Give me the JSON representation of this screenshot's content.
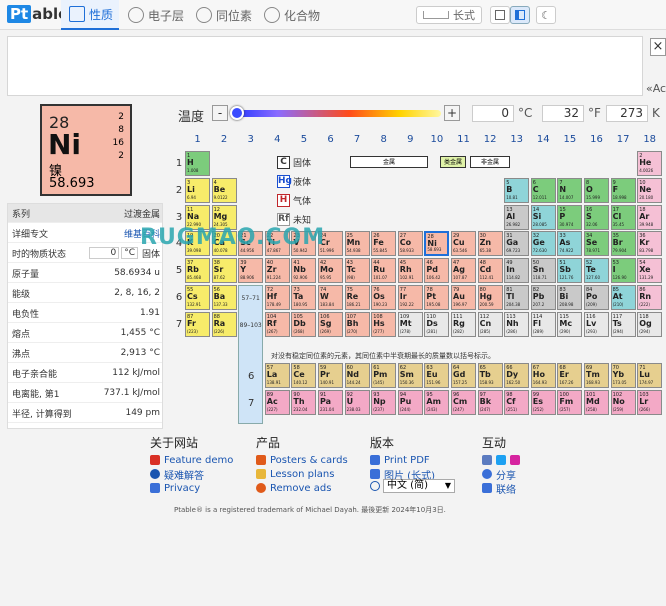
{
  "app": {
    "logo_prefix": "Pt",
    "logo_suffix": "able"
  },
  "tabs": [
    {
      "label": "性质",
      "active": true
    },
    {
      "label": "电子层",
      "active": false
    },
    {
      "label": "同位素",
      "active": false
    },
    {
      "label": "化合物",
      "active": false
    }
  ],
  "layout_buttons": {
    "wide_label": "长式"
  },
  "close_label": "×",
  "right_clip_text": "«Ac",
  "temperature": {
    "label": "温度",
    "minus": "-",
    "plus": "+",
    "celsius": "0",
    "celsius_unit": "°C",
    "fahrenheit": "32",
    "fahrenheit_unit": "°F",
    "kelvin": "273",
    "kelvin_unit": "K"
  },
  "selected": {
    "number": "28",
    "symbol": "Ni",
    "name": "镍",
    "mass": "58.693",
    "shells": [
      "2",
      "8",
      "16",
      "2"
    ]
  },
  "properties": {
    "header_key": "系列",
    "header_value": "过渡金属",
    "rows": [
      {
        "k": "详细专文",
        "v": "维基百科"
      },
      {
        "k": "时的物质状态",
        "v": "固体"
      },
      {
        "k": "原子量",
        "v": "58.6934 u"
      },
      {
        "k": "能级",
        "v": "2, 8, 16, 2"
      },
      {
        "k": "电负性",
        "v": "1.91"
      },
      {
        "k": "熔点",
        "v": "1,455 °C"
      },
      {
        "k": "沸点",
        "v": "2,913 °C"
      },
      {
        "k": "电子亲合能",
        "v": "112 kJ/mol"
      },
      {
        "k": "电离能, 第1",
        "v": "737.1 kJ/mol"
      },
      {
        "k": "半径, 计算得到",
        "v": "149 pm"
      }
    ],
    "state_temp": "0",
    "state_unit": "°C"
  },
  "groups": [
    "1",
    "2",
    "3",
    "4",
    "5",
    "6",
    "7",
    "8",
    "9",
    "10",
    "11",
    "12",
    "13",
    "14",
    "15",
    "16",
    "17",
    "18"
  ],
  "periods": [
    "1",
    "2",
    "3",
    "4",
    "5",
    "6",
    "7"
  ],
  "lanth_period": "6",
  "actin_period": "7",
  "range_6": "57–71",
  "range_7": "89–103",
  "legend": [
    {
      "sym": "C",
      "label": "固体",
      "color": "#000000"
    },
    {
      "sym": "Hg",
      "label": "液体",
      "color": "#1a4fd0"
    },
    {
      "sym": "H",
      "label": "气体",
      "color": "#c0262a"
    },
    {
      "sym": "Rf",
      "label": "未知",
      "color": "#555555"
    }
  ],
  "category_headers": {
    "metal": "金属",
    "nonmetal": "非金属",
    "metalloid": "类金属"
  },
  "note": "对没有稳定同位素的元素，其同位素中半衰期最长的质量数以括号标示。",
  "watermark": "RUGMAO.COM",
  "elements": [
    {
      "n": "1",
      "s": "H",
      "m": "1.008",
      "g": 1,
      "p": 1,
      "c": "#7ccc7c"
    },
    {
      "n": "2",
      "s": "He",
      "m": "4.0026",
      "g": 18,
      "p": 1,
      "c": "#f5c0d5"
    },
    {
      "n": "3",
      "s": "Li",
      "m": "6.94",
      "g": 1,
      "p": 2,
      "c": "#f7ec6a"
    },
    {
      "n": "4",
      "s": "Be",
      "m": "9.0122",
      "g": 2,
      "p": 2,
      "c": "#f7ec6a"
    },
    {
      "n": "5",
      "s": "B",
      "m": "10.81",
      "g": 13,
      "p": 2,
      "c": "#8fd4d8"
    },
    {
      "n": "6",
      "s": "C",
      "m": "12.011",
      "g": 14,
      "p": 2,
      "c": "#7ccc7c"
    },
    {
      "n": "7",
      "s": "N",
      "m": "14.007",
      "g": 15,
      "p": 2,
      "c": "#7ccc7c"
    },
    {
      "n": "8",
      "s": "O",
      "m": "15.999",
      "g": 16,
      "p": 2,
      "c": "#7ccc7c"
    },
    {
      "n": "9",
      "s": "F",
      "m": "18.998",
      "g": 17,
      "p": 2,
      "c": "#7ccc7c"
    },
    {
      "n": "10",
      "s": "Ne",
      "m": "20.180",
      "g": 18,
      "p": 2,
      "c": "#f5c0d5"
    },
    {
      "n": "11",
      "s": "Na",
      "m": "22.990",
      "g": 1,
      "p": 3,
      "c": "#f7ec6a"
    },
    {
      "n": "12",
      "s": "Mg",
      "m": "24.305",
      "g": 2,
      "p": 3,
      "c": "#f7ec6a"
    },
    {
      "n": "13",
      "s": "Al",
      "m": "26.982",
      "g": 13,
      "p": 3,
      "c": "#c9c9c9"
    },
    {
      "n": "14",
      "s": "Si",
      "m": "28.085",
      "g": 14,
      "p": 3,
      "c": "#8fd4d8"
    },
    {
      "n": "15",
      "s": "P",
      "m": "30.974",
      "g": 15,
      "p": 3,
      "c": "#7ccc7c"
    },
    {
      "n": "16",
      "s": "S",
      "m": "32.06",
      "g": 16,
      "p": 3,
      "c": "#7ccc7c"
    },
    {
      "n": "17",
      "s": "Cl",
      "m": "35.45",
      "g": 17,
      "p": 3,
      "c": "#7ccc7c"
    },
    {
      "n": "18",
      "s": "Ar",
      "m": "39.948",
      "g": 18,
      "p": 3,
      "c": "#f5c0d5"
    },
    {
      "n": "19",
      "s": "K",
      "m": "39.098",
      "g": 1,
      "p": 4,
      "c": "#f7ec6a"
    },
    {
      "n": "20",
      "s": "Ca",
      "m": "40.078",
      "g": 2,
      "p": 4,
      "c": "#f7ec6a"
    },
    {
      "n": "21",
      "s": "Sc",
      "m": "44.956",
      "g": 3,
      "p": 4,
      "c": "#f6b9a8"
    },
    {
      "n": "22",
      "s": "Ti",
      "m": "47.867",
      "g": 4,
      "p": 4,
      "c": "#f6b9a8"
    },
    {
      "n": "23",
      "s": "V",
      "m": "50.942",
      "g": 5,
      "p": 4,
      "c": "#f6b9a8"
    },
    {
      "n": "24",
      "s": "Cr",
      "m": "51.996",
      "g": 6,
      "p": 4,
      "c": "#f6b9a8"
    },
    {
      "n": "25",
      "s": "Mn",
      "m": "54.938",
      "g": 7,
      "p": 4,
      "c": "#f6b9a8"
    },
    {
      "n": "26",
      "s": "Fe",
      "m": "55.845",
      "g": 8,
      "p": 4,
      "c": "#f6b9a8"
    },
    {
      "n": "27",
      "s": "Co",
      "m": "58.933",
      "g": 9,
      "p": 4,
      "c": "#f6b9a8"
    },
    {
      "n": "28",
      "s": "Ni",
      "m": "58.693",
      "g": 10,
      "p": 4,
      "c": "#f6b9a8"
    },
    {
      "n": "29",
      "s": "Cu",
      "m": "63.546",
      "g": 11,
      "p": 4,
      "c": "#f6b9a8"
    },
    {
      "n": "30",
      "s": "Zn",
      "m": "65.38",
      "g": 12,
      "p": 4,
      "c": "#f6b9a8"
    },
    {
      "n": "31",
      "s": "Ga",
      "m": "69.723",
      "g": 13,
      "p": 4,
      "c": "#c9c9c9"
    },
    {
      "n": "32",
      "s": "Ge",
      "m": "72.630",
      "g": 14,
      "p": 4,
      "c": "#8fd4d8"
    },
    {
      "n": "33",
      "s": "As",
      "m": "74.922",
      "g": 15,
      "p": 4,
      "c": "#8fd4d8"
    },
    {
      "n": "34",
      "s": "Se",
      "m": "78.971",
      "g": 16,
      "p": 4,
      "c": "#7ccc7c"
    },
    {
      "n": "35",
      "s": "Br",
      "m": "79.904",
      "g": 17,
      "p": 4,
      "c": "#7ccc7c"
    },
    {
      "n": "36",
      "s": "Kr",
      "m": "83.798",
      "g": 18,
      "p": 4,
      "c": "#f5c0d5"
    },
    {
      "n": "37",
      "s": "Rb",
      "m": "85.468",
      "g": 1,
      "p": 5,
      "c": "#f7ec6a"
    },
    {
      "n": "38",
      "s": "Sr",
      "m": "87.62",
      "g": 2,
      "p": 5,
      "c": "#f7ec6a"
    },
    {
      "n": "39",
      "s": "Y",
      "m": "88.906",
      "g": 3,
      "p": 5,
      "c": "#f6b9a8"
    },
    {
      "n": "40",
      "s": "Zr",
      "m": "91.224",
      "g": 4,
      "p": 5,
      "c": "#f6b9a8"
    },
    {
      "n": "41",
      "s": "Nb",
      "m": "92.906",
      "g": 5,
      "p": 5,
      "c": "#f6b9a8"
    },
    {
      "n": "42",
      "s": "Mo",
      "m": "95.95",
      "g": 6,
      "p": 5,
      "c": "#f6b9a8"
    },
    {
      "n": "43",
      "s": "Tc",
      "m": "(98)",
      "g": 7,
      "p": 5,
      "c": "#f6b9a8"
    },
    {
      "n": "44",
      "s": "Ru",
      "m": "101.07",
      "g": 8,
      "p": 5,
      "c": "#f6b9a8"
    },
    {
      "n": "45",
      "s": "Rh",
      "m": "102.91",
      "g": 9,
      "p": 5,
      "c": "#f6b9a8"
    },
    {
      "n": "46",
      "s": "Pd",
      "m": "106.42",
      "g": 10,
      "p": 5,
      "c": "#f6b9a8"
    },
    {
      "n": "47",
      "s": "Ag",
      "m": "107.87",
      "g": 11,
      "p": 5,
      "c": "#f6b9a8"
    },
    {
      "n": "48",
      "s": "Cd",
      "m": "112.41",
      "g": 12,
      "p": 5,
      "c": "#f6b9a8"
    },
    {
      "n": "49",
      "s": "In",
      "m": "114.82",
      "g": 13,
      "p": 5,
      "c": "#c9c9c9"
    },
    {
      "n": "50",
      "s": "Sn",
      "m": "118.71",
      "g": 14,
      "p": 5,
      "c": "#c9c9c9"
    },
    {
      "n": "51",
      "s": "Sb",
      "m": "121.76",
      "g": 15,
      "p": 5,
      "c": "#8fd4d8"
    },
    {
      "n": "52",
      "s": "Te",
      "m": "127.60",
      "g": 16,
      "p": 5,
      "c": "#8fd4d8"
    },
    {
      "n": "53",
      "s": "I",
      "m": "126.90",
      "g": 17,
      "p": 5,
      "c": "#7ccc7c"
    },
    {
      "n": "54",
      "s": "Xe",
      "m": "131.29",
      "g": 18,
      "p": 5,
      "c": "#f5c0d5"
    },
    {
      "n": "55",
      "s": "Cs",
      "m": "132.91",
      "g": 1,
      "p": 6,
      "c": "#f7ec6a"
    },
    {
      "n": "56",
      "s": "Ba",
      "m": "137.33",
      "g": 2,
      "p": 6,
      "c": "#f7ec6a"
    },
    {
      "n": "72",
      "s": "Hf",
      "m": "178.49",
      "g": 4,
      "p": 6,
      "c": "#f6b9a8"
    },
    {
      "n": "73",
      "s": "Ta",
      "m": "180.95",
      "g": 5,
      "p": 6,
      "c": "#f6b9a8"
    },
    {
      "n": "74",
      "s": "W",
      "m": "183.84",
      "g": 6,
      "p": 6,
      "c": "#f6b9a8"
    },
    {
      "n": "75",
      "s": "Re",
      "m": "186.21",
      "g": 7,
      "p": 6,
      "c": "#f6b9a8"
    },
    {
      "n": "76",
      "s": "Os",
      "m": "190.23",
      "g": 8,
      "p": 6,
      "c": "#f6b9a8"
    },
    {
      "n": "77",
      "s": "Ir",
      "m": "192.22",
      "g": 9,
      "p": 6,
      "c": "#f6b9a8"
    },
    {
      "n": "78",
      "s": "Pt",
      "m": "195.08",
      "g": 10,
      "p": 6,
      "c": "#f6b9a8"
    },
    {
      "n": "79",
      "s": "Au",
      "m": "196.97",
      "g": 11,
      "p": 6,
      "c": "#f6b9a8"
    },
    {
      "n": "80",
      "s": "Hg",
      "m": "200.59",
      "g": 12,
      "p": 6,
      "c": "#f6b9a8"
    },
    {
      "n": "81",
      "s": "Tl",
      "m": "204.38",
      "g": 13,
      "p": 6,
      "c": "#c9c9c9"
    },
    {
      "n": "82",
      "s": "Pb",
      "m": "207.2",
      "g": 14,
      "p": 6,
      "c": "#c9c9c9"
    },
    {
      "n": "83",
      "s": "Bi",
      "m": "208.98",
      "g": 15,
      "p": 6,
      "c": "#c9c9c9"
    },
    {
      "n": "84",
      "s": "Po",
      "m": "(209)",
      "g": 16,
      "p": 6,
      "c": "#c9c9c9"
    },
    {
      "n": "85",
      "s": "At",
      "m": "(210)",
      "g": 17,
      "p": 6,
      "c": "#8fd4d8"
    },
    {
      "n": "86",
      "s": "Rn",
      "m": "(222)",
      "g": 18,
      "p": 6,
      "c": "#f5c0d5"
    },
    {
      "n": "87",
      "s": "Fr",
      "m": "(223)",
      "g": 1,
      "p": 7,
      "c": "#f7ec6a"
    },
    {
      "n": "88",
      "s": "Ra",
      "m": "(226)",
      "g": 2,
      "p": 7,
      "c": "#f7ec6a"
    },
    {
      "n": "104",
      "s": "Rf",
      "m": "(267)",
      "g": 4,
      "p": 7,
      "c": "#f6b9a8"
    },
    {
      "n": "105",
      "s": "Db",
      "m": "(268)",
      "g": 5,
      "p": 7,
      "c": "#f6b9a8"
    },
    {
      "n": "106",
      "s": "Sg",
      "m": "(269)",
      "g": 6,
      "p": 7,
      "c": "#f6b9a8"
    },
    {
      "n": "107",
      "s": "Bh",
      "m": "(270)",
      "g": 7,
      "p": 7,
      "c": "#f6b9a8"
    },
    {
      "n": "108",
      "s": "Hs",
      "m": "(277)",
      "g": 8,
      "p": 7,
      "c": "#f6b9a8"
    },
    {
      "n": "109",
      "s": "Mt",
      "m": "(278)",
      "g": 9,
      "p": 7,
      "c": "#e8e8e8"
    },
    {
      "n": "110",
      "s": "Ds",
      "m": "(281)",
      "g": 10,
      "p": 7,
      "c": "#e8e8e8"
    },
    {
      "n": "111",
      "s": "Rg",
      "m": "(282)",
      "g": 11,
      "p": 7,
      "c": "#e8e8e8"
    },
    {
      "n": "112",
      "s": "Cn",
      "m": "(285)",
      "g": 12,
      "p": 7,
      "c": "#e8e8e8"
    },
    {
      "n": "113",
      "s": "Nh",
      "m": "(286)",
      "g": 13,
      "p": 7,
      "c": "#e8e8e8"
    },
    {
      "n": "114",
      "s": "Fl",
      "m": "(289)",
      "g": 14,
      "p": 7,
      "c": "#e8e8e8"
    },
    {
      "n": "115",
      "s": "Mc",
      "m": "(290)",
      "g": 15,
      "p": 7,
      "c": "#e8e8e8"
    },
    {
      "n": "116",
      "s": "Lv",
      "m": "(293)",
      "g": 16,
      "p": 7,
      "c": "#e8e8e8"
    },
    {
      "n": "117",
      "s": "Ts",
      "m": "(294)",
      "g": 17,
      "p": 7,
      "c": "#e8e8e8"
    },
    {
      "n": "118",
      "s": "Og",
      "m": "(294)",
      "g": 18,
      "p": 7,
      "c": "#e8e8e8"
    }
  ],
  "lanthanides": [
    {
      "n": "57",
      "s": "La",
      "m": "138.91"
    },
    {
      "n": "58",
      "s": "Ce",
      "m": "140.12"
    },
    {
      "n": "59",
      "s": "Pr",
      "m": "140.91"
    },
    {
      "n": "60",
      "s": "Nd",
      "m": "144.24"
    },
    {
      "n": "61",
      "s": "Pm",
      "m": "(145)"
    },
    {
      "n": "62",
      "s": "Sm",
      "m": "150.36"
    },
    {
      "n": "63",
      "s": "Eu",
      "m": "151.96"
    },
    {
      "n": "64",
      "s": "Gd",
      "m": "157.25"
    },
    {
      "n": "65",
      "s": "Tb",
      "m": "158.93"
    },
    {
      "n": "66",
      "s": "Dy",
      "m": "162.50"
    },
    {
      "n": "67",
      "s": "Ho",
      "m": "164.93"
    },
    {
      "n": "68",
      "s": "Er",
      "m": "167.26"
    },
    {
      "n": "69",
      "s": "Tm",
      "m": "168.93"
    },
    {
      "n": "70",
      "s": "Yb",
      "m": "173.05"
    },
    {
      "n": "71",
      "s": "Lu",
      "m": "174.97"
    }
  ],
  "actinides": [
    {
      "n": "89",
      "s": "Ac",
      "m": "(227)"
    },
    {
      "n": "90",
      "s": "Th",
      "m": "232.04"
    },
    {
      "n": "91",
      "s": "Pa",
      "m": "231.04"
    },
    {
      "n": "92",
      "s": "U",
      "m": "238.03"
    },
    {
      "n": "93",
      "s": "Np",
      "m": "(237)"
    },
    {
      "n": "94",
      "s": "Pu",
      "m": "(244)"
    },
    {
      "n": "95",
      "s": "Am",
      "m": "(243)"
    },
    {
      "n": "96",
      "s": "Cm",
      "m": "(247)"
    },
    {
      "n": "97",
      "s": "Bk",
      "m": "(247)"
    },
    {
      "n": "98",
      "s": "Cf",
      "m": "(251)"
    },
    {
      "n": "99",
      "s": "Es",
      "m": "(252)"
    },
    {
      "n": "100",
      "s": "Fm",
      "m": "(257)"
    },
    {
      "n": "101",
      "s": "Md",
      "m": "(258)"
    },
    {
      "n": "102",
      "s": "No",
      "m": "(259)"
    },
    {
      "n": "103",
      "s": "Lr",
      "m": "(266)"
    }
  ],
  "colors": {
    "lanthanide": "#e6cf8f",
    "actinide": "#f3a9c6",
    "range_box": "#cfe4f7"
  },
  "footer": {
    "about": {
      "title": "关于网站",
      "items": [
        "Feature demo",
        "疑难解答",
        "Privacy"
      ]
    },
    "products": {
      "title": "产品",
      "items": [
        "Posters & cards",
        "Lesson plans",
        "Remove ads"
      ]
    },
    "version": {
      "title": "版本",
      "items": [
        "Print PDF",
        "图片 (长式)"
      ],
      "language": "中文 (简)"
    },
    "interact": {
      "title": "互动",
      "items": [
        "分享",
        "联络"
      ]
    },
    "copyright": "Ptable® is a registered trademark of Michael Dayah. 最後更新 2024年10月3日."
  }
}
